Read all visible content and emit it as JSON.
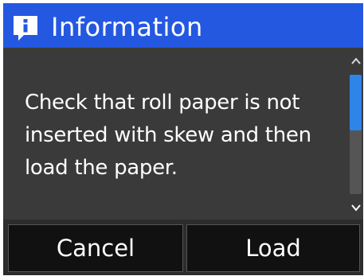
{
  "dialog": {
    "title": "Information",
    "icon": "info-speech-bubble-icon",
    "message": "Check that roll paper is not inserted with skew and then load the paper."
  },
  "scrollbar": {
    "up_icon": "chevron-up-icon",
    "down_icon": "chevron-down-icon",
    "position": 0.0
  },
  "buttons": {
    "cancel_label": "Cancel",
    "load_label": "Load"
  },
  "colors": {
    "title_bar": "#2458e0",
    "background": "#3a3a3a",
    "button": "#111111",
    "scroll_thumb": "#2f84e8"
  }
}
